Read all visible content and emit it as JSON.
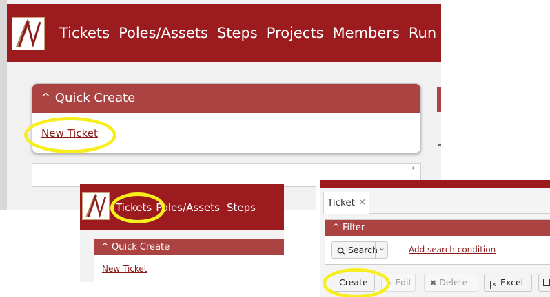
{
  "colors": {
    "header": "#9b1b1e",
    "panel": "#ac4343",
    "link": "#8b1a1a",
    "highlight": "#f7ee1e"
  },
  "shot1": {
    "nav": [
      "Tickets",
      "Poles/Assets",
      "Steps",
      "Projects",
      "Members",
      "Run"
    ],
    "panel_title": "^ Quick Create",
    "new_ticket": "New Ticket",
    "scroll_glyph": "⠆"
  },
  "shot2": {
    "nav": [
      "Tickets",
      "Poles/Assets",
      "Steps"
    ],
    "panel_title": "^ Quick Create",
    "new_ticket": "New Ticket"
  },
  "shot3": {
    "tab_label": "Ticket",
    "tab_close": "×",
    "filter_title": "^ Filter",
    "search_label": "Search",
    "search_dropdown": "⌄",
    "add_condition": "Add search condition",
    "buttons": {
      "create": "Create",
      "edit": "Edit",
      "delete": "Delete",
      "excel": "Excel"
    }
  },
  "icons": [
    "app-logo-icon",
    "chevron-up-icon",
    "search-icon",
    "chevron-down-icon",
    "close-icon",
    "edit-icon",
    "delete-icon",
    "excel-icon"
  ]
}
